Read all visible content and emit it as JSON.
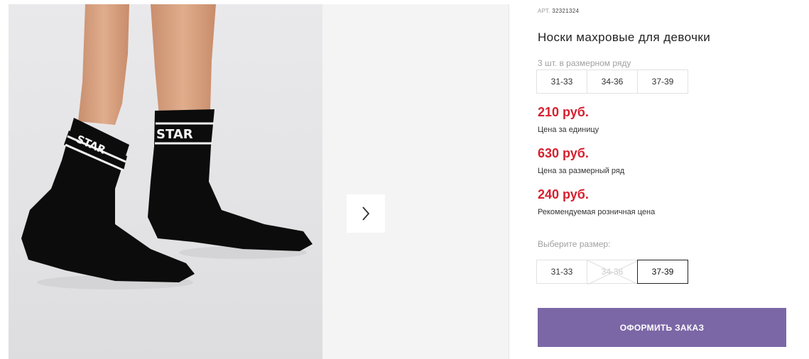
{
  "product": {
    "art_label": "АРТ.",
    "art_number": "32321324",
    "title": "Носки махровые для девочки"
  },
  "gallery": {
    "sock_print": "STAR",
    "next_icon": "chevron-right-icon"
  },
  "size_range": {
    "label": "3 шт. в размерном ряду",
    "sizes": [
      "31-33",
      "34-36",
      "37-39"
    ]
  },
  "prices": [
    {
      "value": "210 руб.",
      "note": "Цена за единицу"
    },
    {
      "value": "630 руб.",
      "note": "Цена за размерный ряд"
    },
    {
      "value": "240 руб.",
      "note": "Рекомендуемая розничная цена"
    }
  ],
  "size_select": {
    "label": "Выберите размер:",
    "options": [
      {
        "label": "31-33",
        "state": "available"
      },
      {
        "label": "34-36",
        "state": "unavailable"
      },
      {
        "label": "37-39",
        "state": "selected"
      }
    ]
  },
  "order_button": {
    "label": "ОФОРМИТЬ ЗАКАЗ"
  },
  "colors": {
    "price": "#d6202f",
    "order_button": "#7b67a6"
  }
}
